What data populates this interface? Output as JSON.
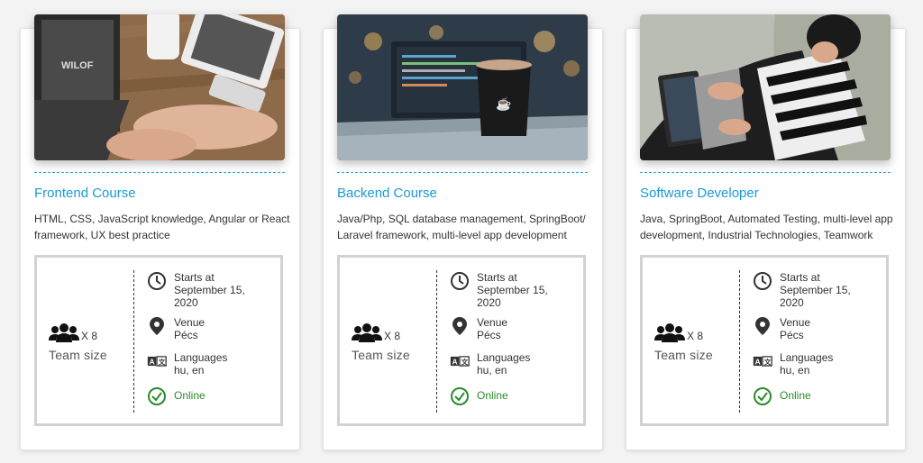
{
  "courses": [
    {
      "title": "Frontend Course",
      "description": "HTML, CSS, JavaScript knowledge, Angular or React framework, UX best practice",
      "photo_icon": "laptop-typing-photo",
      "team_count": "X 8",
      "team_label": "Team size",
      "starts_label": "Starts at",
      "starts_date": "September 15, 2020",
      "venue_label": "Venue",
      "venue_value": "Pécs",
      "languages_label": "Languages",
      "languages_value": "hu, en",
      "status": "Online"
    },
    {
      "title": "Backend Course",
      "description": "Java/Php, SQL database management, SpringBoot/ Laravel framework, multi-level app development",
      "photo_icon": "coffee-laptop-photo",
      "team_count": "X 8",
      "team_label": "Team size",
      "starts_label": "Starts at",
      "starts_date": "September 15, 2020",
      "venue_label": "Venue",
      "venue_value": "Pécs",
      "languages_label": "Languages",
      "languages_value": "hu, en",
      "status": "Online"
    },
    {
      "title": "Software Developer",
      "description": "Java, SpringBoot, Automated Testing, multi-level app development, Industrial Technologies, Teamwork",
      "photo_icon": "developer-laptop-photo",
      "team_count": "X 8",
      "team_label": "Team size",
      "starts_label": "Starts at",
      "starts_date": "September 15, 2020",
      "venue_label": "Venue",
      "venue_value": "Pécs",
      "languages_label": "Languages",
      "languages_value": "hu, en",
      "status": "Online"
    }
  ],
  "colors": {
    "accent": "#1a9ad6",
    "divider": "#2aa7d9",
    "online": "#2b8a2b",
    "info_border": "#d2d2d2"
  },
  "icons": {
    "team": "team-icon",
    "clock": "clock-icon",
    "venue": "map-pin-icon",
    "language": "translate-icon",
    "online": "check-circle-icon"
  }
}
